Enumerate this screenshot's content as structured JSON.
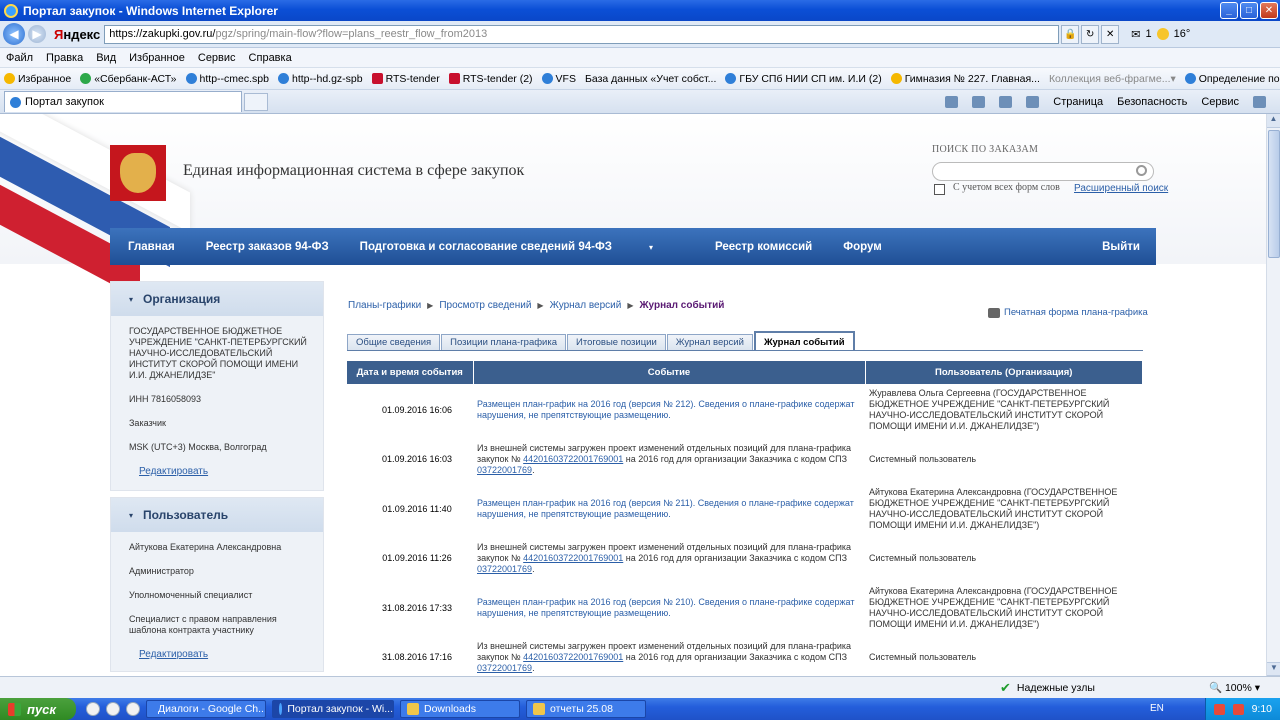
{
  "window": {
    "title": "Портал закупок - Windows Internet Explorer"
  },
  "addressbar": {
    "brand_red": "Я",
    "brand_black": "ндекс",
    "url_domain": "https://zakupki.gov.ru/",
    "url_path": "pgz/spring/main-flow?flow=plans_reestr_flow_from2013",
    "temperature": "16°",
    "counter": "1"
  },
  "menu": [
    "Файл",
    "Правка",
    "Вид",
    "Избранное",
    "Сервис",
    "Справка"
  ],
  "favorites": {
    "label": "Избранное",
    "items": [
      {
        "text": "«Сбербанк-АСТ»",
        "icon": "green"
      },
      {
        "text": "http--cmec.spb",
        "icon": "ie"
      },
      {
        "text": "http--hd.gz-spb",
        "icon": "ie"
      },
      {
        "text": "RTS-tender",
        "icon": "rts"
      },
      {
        "text": "RTS-tender (2)",
        "icon": "rts"
      },
      {
        "text": "VFS",
        "icon": "ie"
      },
      {
        "text": "База данных «Учет собст...",
        "icon": "page"
      },
      {
        "text": "ГБУ СПб НИИ СП им. И.И (2)",
        "icon": "ie"
      },
      {
        "text": "Гимназия № 227. Главная...",
        "icon": "star"
      },
      {
        "text": "Коллекция веб-фрагме...",
        "icon": "page",
        "gray": true
      },
      {
        "text": "Определение поставщика",
        "icon": "ie"
      }
    ]
  },
  "browser_tab": {
    "title": "Портал закупок"
  },
  "commandbar": {
    "page": "Страница",
    "security": "Безопасность",
    "tools": "Сервис"
  },
  "site": {
    "title": "Единая информационная система в сфере закупок",
    "search_heading": "ПОИСК ПО ЗАКАЗАМ",
    "search_checkbox": "С учетом всех форм слов",
    "advanced_search": "Расширенный поиск",
    "nav": [
      "Главная",
      "Реестр заказов 94-ФЗ",
      "Подготовка и согласование сведений 94-ФЗ",
      "Реестр комиссий",
      "Форум"
    ],
    "exit": "Выйти"
  },
  "sidebar": {
    "org": {
      "heading": "Организация",
      "name": "ГОСУДАРСТВЕННОЕ БЮДЖЕТНОЕ УЧРЕЖДЕНИЕ \"САНКТ-ПЕТЕРБУРГСКИЙ НАУЧНО-ИССЛЕДОВАТЕЛЬСКИЙ ИНСТИТУТ СКОРОЙ ПОМОЩИ ИМЕНИ И.И. ДЖАНЕЛИДЗЕ\"",
      "inn": "ИНН 7816058093",
      "role": "Заказчик",
      "timezone": "MSK (UTC+3) Москва, Волгоград",
      "edit": "Редактировать"
    },
    "user": {
      "heading": "Пользователь",
      "name": "Айтукова Екатерина Александровна",
      "role": "Администратор",
      "position": "Уполномоченный специалист",
      "rights": "Специалист с правом направления шаблона контракта участнику",
      "edit": "Редактировать"
    }
  },
  "breadcrumb": [
    "Планы-графики",
    "Просмотр сведений",
    "Журнал версий",
    "Журнал событий"
  ],
  "print_link": "Печатная форма плана-графика",
  "tabs": [
    "Общие сведения",
    "Позиции плана-графика",
    "Итоговые позиции",
    "Журнал версий",
    "Журнал событий"
  ],
  "table": {
    "headers": [
      "Дата и время события",
      "Событие",
      "Пользователь (Организация)"
    ],
    "rows": [
      {
        "date": "01.09.2016 16:06",
        "type": "publish",
        "event": "Размещен план-график на 2016 год (версия № 212). Сведения о плане-графике содержат нарушения, не препятствующие размещению.",
        "user": "Журавлева Ольга Сергеевна (ГОСУДАРСТВЕННОЕ БЮДЖЕТНОЕ УЧРЕЖДЕНИЕ \"САНКТ-ПЕТЕРБУРГСКИЙ НАУЧНО-ИССЛЕДОВАТЕЛЬСКИЙ ИНСТИТУТ СКОРОЙ ПОМОЩИ ИМЕНИ И.И. ДЖАНЕЛИДЗЕ\")"
      },
      {
        "date": "01.09.2016 16:03",
        "type": "import",
        "event_pre": "Из внешней системы загружен проект изменений отдельных позиций для плана-графика закупок № ",
        "event_num": "44201603722001769001",
        "event_mid": " на 2016 год для организации Заказчика с кодом СПЗ ",
        "event_code": "03722001769",
        "event_post": ".",
        "user": "Системный пользователь"
      },
      {
        "date": "01.09.2016 11:40",
        "type": "publish",
        "event": "Размещен план-график на 2016 год (версия № 211). Сведения о плане-графике содержат нарушения, не препятствующие размещению.",
        "user": "Айтукова Екатерина Александровна (ГОСУДАРСТВЕННОЕ БЮДЖЕТНОЕ УЧРЕЖДЕНИЕ \"САНКТ-ПЕТЕРБУРГСКИЙ НАУЧНО-ИССЛЕДОВАТЕЛЬСКИЙ ИНСТИТУТ СКОРОЙ ПОМОЩИ ИМЕНИ И.И. ДЖАНЕЛИДЗЕ\")"
      },
      {
        "date": "01.09.2016 11:26",
        "type": "import",
        "event_pre": "Из внешней системы загружен проект изменений отдельных позиций для плана-графика закупок № ",
        "event_num": "44201603722001769001",
        "event_mid": " на 2016 год для организации Заказчика с кодом СПЗ ",
        "event_code": "03722001769",
        "event_post": ".",
        "user": "Системный пользователь"
      },
      {
        "date": "31.08.2016 17:33",
        "type": "publish",
        "event": "Размещен план-график на 2016 год (версия № 210). Сведения о плане-графике содержат нарушения, не препятствующие размещению.",
        "user": "Айтукова Екатерина Александровна (ГОСУДАРСТВЕННОЕ БЮДЖЕТНОЕ УЧРЕЖДЕНИЕ \"САНКТ-ПЕТЕРБУРГСКИЙ НАУЧНО-ИССЛЕДОВАТЕЛЬСКИЙ ИНСТИТУТ СКОРОЙ ПОМОЩИ ИМЕНИ И.И. ДЖАНЕЛИДЗЕ\")"
      },
      {
        "date": "31.08.2016 17:16",
        "type": "import",
        "event_pre": "Из внешней системы загружен проект изменений отдельных позиций для плана-графика закупок № ",
        "event_num": "44201603722001769001",
        "event_mid": " на 2016 год для организации Заказчика с кодом СПЗ ",
        "event_code": "03722001769",
        "event_post": ".",
        "user": "Системный пользователь"
      }
    ]
  },
  "statusbar": {
    "zone": "Надежные узлы",
    "zoom": "100%"
  },
  "taskbar": {
    "start": "пуск",
    "tasks": [
      {
        "label": "Диалоги - Google Ch...",
        "icon": "chrome",
        "active": false
      },
      {
        "label": "Портал закупок - Wi...",
        "icon": "ie",
        "active": true
      },
      {
        "label": "Downloads",
        "icon": "folder",
        "active": false
      },
      {
        "label": "отчеты 25.08",
        "icon": "folder",
        "active": false
      }
    ],
    "lang": "EN",
    "clock": "9:10"
  }
}
